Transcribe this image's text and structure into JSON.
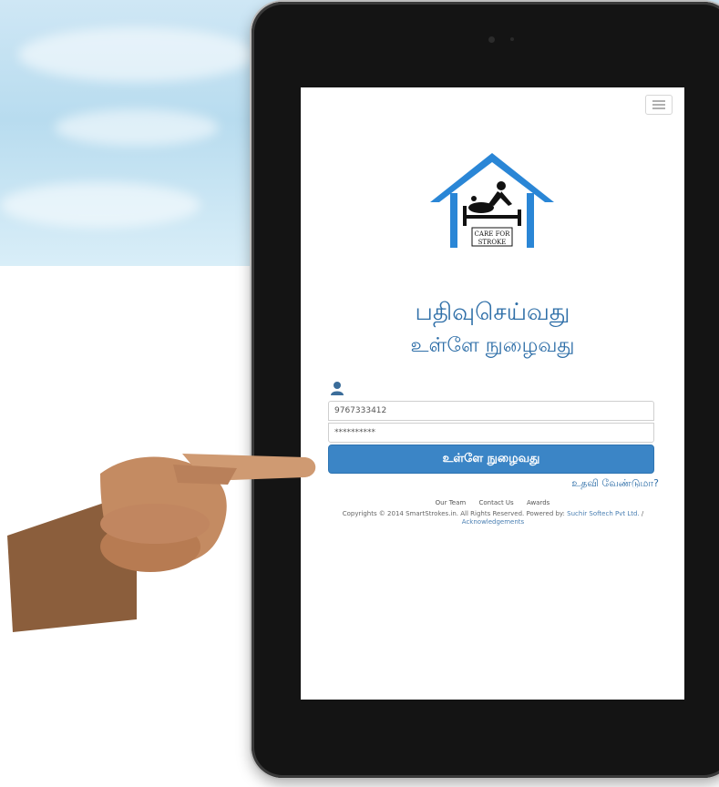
{
  "app": {
    "logo_text_line1": "CARE FOR",
    "logo_text_line2": "STROKE",
    "register_title": "பதிவுசெய்வது",
    "login_title": "உள்ளே நுழைவது"
  },
  "login_form": {
    "username_value": "9767333412",
    "password_value": "**********",
    "submit_label": "உள்ளே நுழைவது",
    "help_link": "உதவி வேண்டுமா?"
  },
  "footer": {
    "links": [
      "Our Team",
      "Contact Us",
      "Awards"
    ],
    "copyright_prefix": "Copyrights © 2014 SmartStrokes.in. All Rights Reserved. Powered by:",
    "company_link": "Suchir Softech Pvt Ltd.",
    "separator": "/",
    "acknowledgements_link": "Acknowledgements"
  },
  "colors": {
    "accent": "#3b85c6",
    "title_text": "#2f6fa8",
    "sky": "#b8dcef",
    "tablet_frame": "#141414"
  },
  "icons": {
    "menu": "hamburger-icon",
    "user": "user-icon",
    "logo": "house-logo"
  }
}
